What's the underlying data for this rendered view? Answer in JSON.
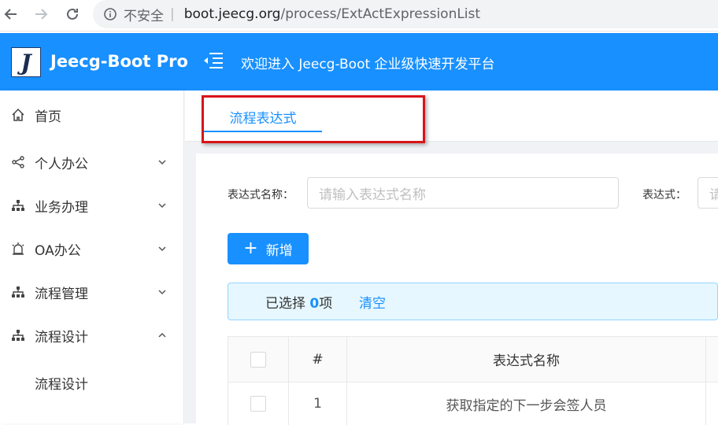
{
  "browser": {
    "security_label": "不安全",
    "separator": "|",
    "url_host": "boot.jeecg.org",
    "url_path": "/process/ExtActExpressionList"
  },
  "header": {
    "logo_letter": "J",
    "app_title": "Jeecg-Boot Pro",
    "welcome_text": "欢迎进入 Jeecg-Boot 企业级快速开发平台",
    "accent_color": "#1890ff"
  },
  "sidebar": {
    "items": [
      {
        "label": "首页",
        "icon": "home-icon"
      },
      {
        "label": "个人办公",
        "icon": "share-icon",
        "arrow": "down"
      },
      {
        "label": "业务办理",
        "icon": "sitemap-icon",
        "arrow": "down"
      },
      {
        "label": "OA办公",
        "icon": "alarm-icon",
        "arrow": "down"
      },
      {
        "label": "流程管理",
        "icon": "sitemap-icon",
        "arrow": "down"
      },
      {
        "label": "流程设计",
        "icon": "sitemap-icon",
        "arrow": "up"
      }
    ],
    "submenu": [
      {
        "label": "流程设计"
      }
    ]
  },
  "tabs": [
    {
      "label": "流程表达式",
      "active": true
    }
  ],
  "search": {
    "name_label": "表达式名称：",
    "name_placeholder": "请输入表达式名称",
    "expr_label": "表达式：",
    "expr_placeholder": "请"
  },
  "toolbar": {
    "add_plus": "+",
    "add_label": "新增"
  },
  "selection": {
    "prefix": "已选择",
    "count": "0",
    "suffix": "项",
    "clear_label": "清空"
  },
  "table": {
    "columns": [
      "#",
      "表达式名称"
    ],
    "rows": [
      {
        "index": "1",
        "name": "获取指定的下一步会签人员"
      }
    ]
  }
}
